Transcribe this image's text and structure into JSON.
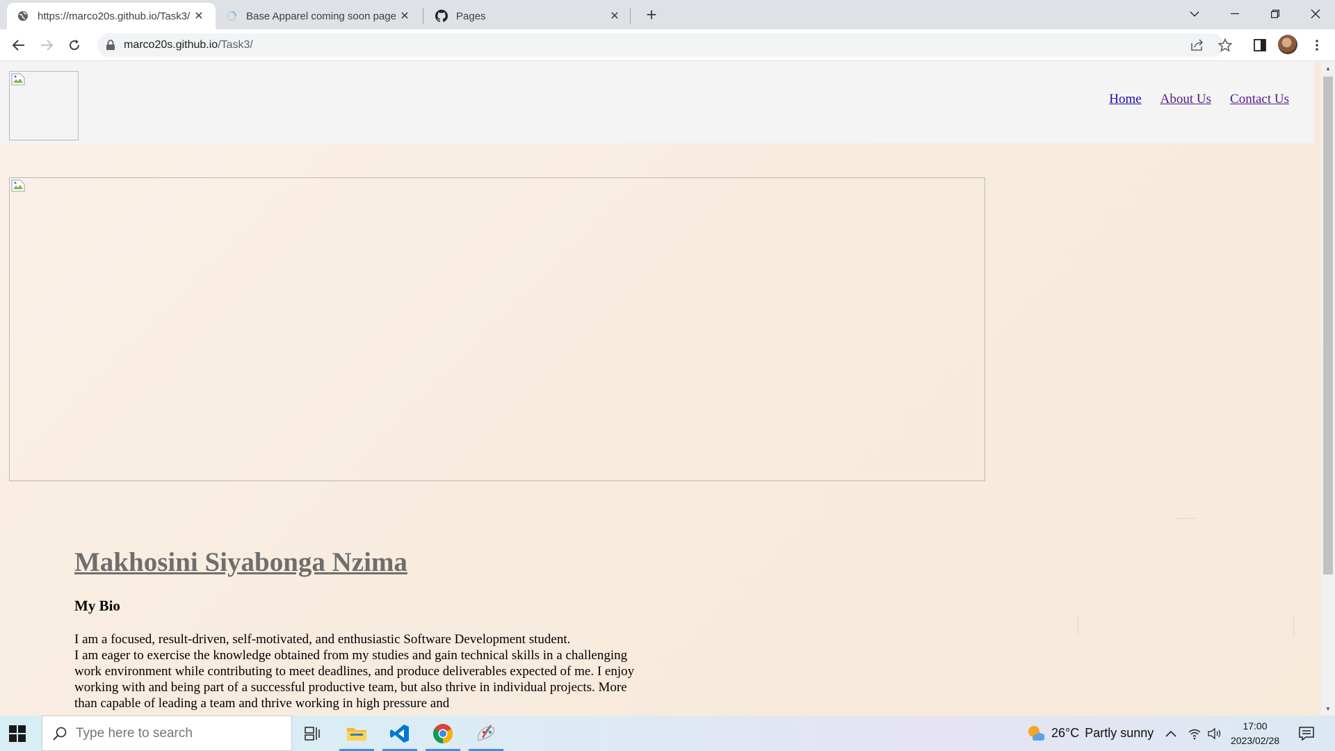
{
  "browser": {
    "tabs": [
      {
        "title": "https://marco20s.github.io/Task3/",
        "icon": "globe-icon",
        "active": true
      },
      {
        "title": "Base Apparel coming soon page",
        "icon": "loading-icon",
        "active": false
      },
      {
        "title": "Pages",
        "icon": "github-icon",
        "active": false
      }
    ],
    "address": {
      "host": "marco20s.github.io",
      "path": "/Task3/"
    }
  },
  "page": {
    "nav": [
      {
        "label": "Home"
      },
      {
        "label": "About Us"
      },
      {
        "label": "Contact Us"
      }
    ],
    "name": "Makhosini Siyabonga Nzima",
    "bio_heading": "My Bio",
    "bio_lines": [
      "I am a focused, result-driven, self-motivated, and enthusiastic Software Development student.",
      "I am eager to exercise the knowledge obtained from my studies and gain technical skills in a challenging work environment while contributing to meet deadlines, and produce deliverables expected of me. I enjoy working with and being part of a successful productive team, but also thrive in individual projects. More than capable of leading a team and thrive working in high pressure and"
    ]
  },
  "taskbar": {
    "search_placeholder": "Type here to search",
    "weather": {
      "temp": "26°C",
      "condition": "Partly sunny"
    },
    "time": "17:00",
    "date": "2023/02/28"
  },
  "colors": {
    "page_bg": "#f8ecdf",
    "header_bg": "#f4f4f4",
    "link": "#1a0dab",
    "visited_link": "#551a8b",
    "name_heading": "#6e6e6e"
  }
}
